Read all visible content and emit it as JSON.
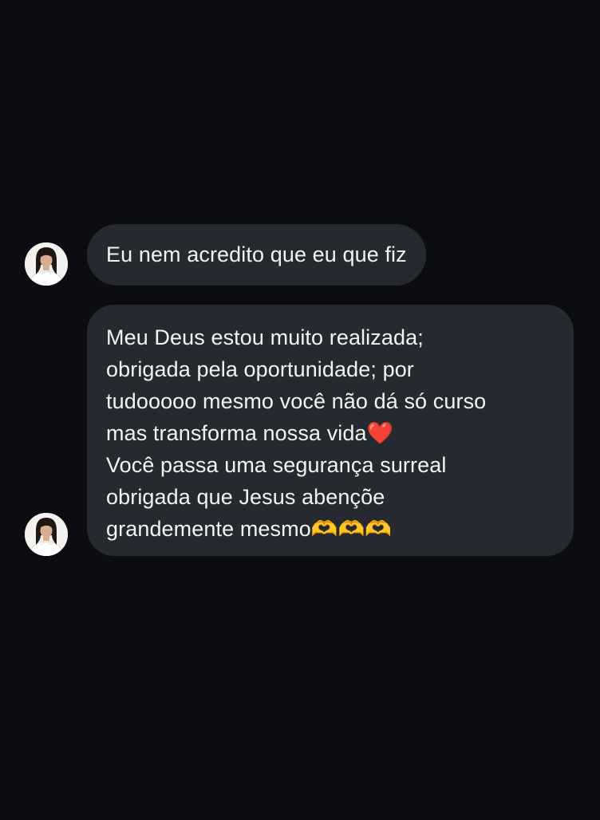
{
  "thread": {
    "messages": [
      {
        "sender": "incoming",
        "lines": [
          "Eu nem acredito que eu que fiz"
        ]
      },
      {
        "sender": "incoming",
        "lines": [
          "Meu Deus estou muito realizada;",
          "obrigada pela oportunidade; por",
          "tudooooo mesmo você não dá só curso",
          "mas transforma nossa vida",
          "Você passa uma segurança surreal",
          "obrigada que Jesus abençõe",
          "grandemente mesmo"
        ],
        "emoji": {
          "heart": "❤️",
          "heart_hands": "🫶🫶🫶"
        }
      }
    ]
  },
  "colors": {
    "background": "#0b0d12",
    "bubble": "#262930",
    "text": "#f2f3f5"
  },
  "icons": {
    "avatar": "avatar-photo-icon",
    "heart": "red-heart-emoji",
    "heart_hands": "heart-hands-emoji"
  }
}
